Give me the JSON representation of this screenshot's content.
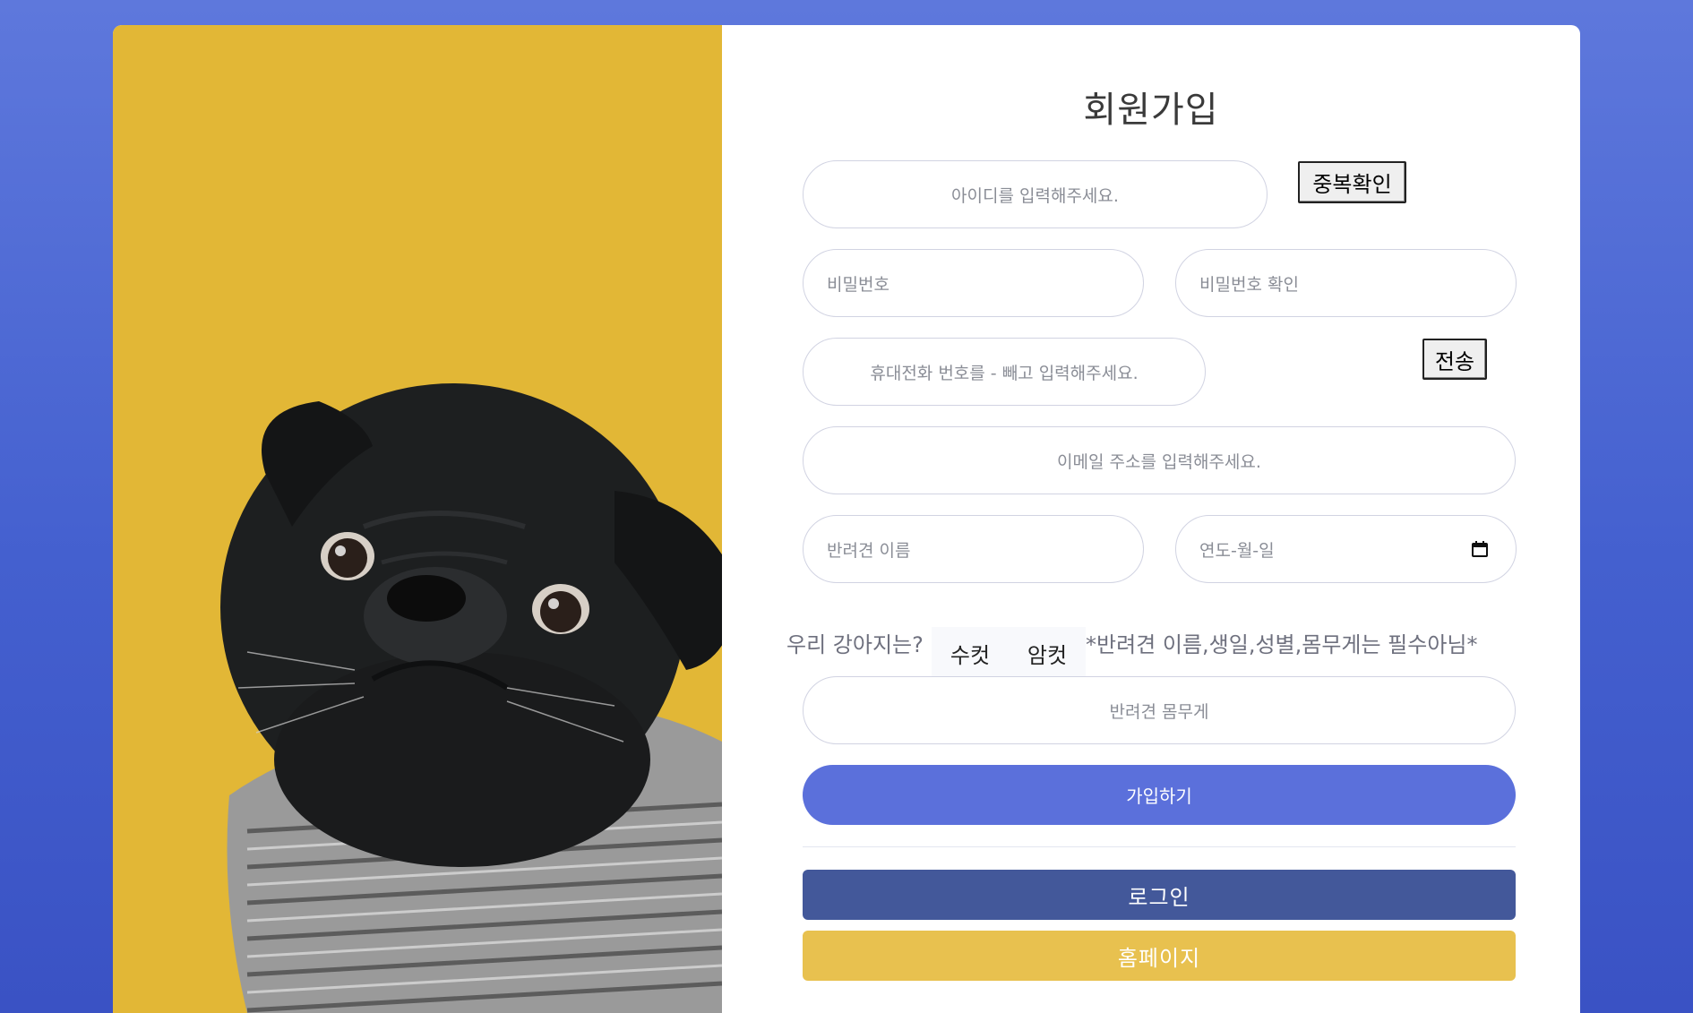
{
  "signup": {
    "title": "회원가입",
    "userid": {
      "placeholder": "아이디를 입력해주세요.",
      "check_button": "중복확인"
    },
    "password": {
      "placeholder": "비밀번호"
    },
    "password_confirm": {
      "placeholder": "비밀번호 확인"
    },
    "phone": {
      "placeholder": "휴대전화 번호를 - 빼고 입력해주세요.",
      "send_button": "전송"
    },
    "email": {
      "placeholder": "이메일 주소를 입력해주세요."
    },
    "pet_name": {
      "placeholder": "반려견 이름"
    },
    "pet_birthday": {
      "placeholder": "연도-월-일",
      "icon": "calendar-icon"
    },
    "gender": {
      "label": "우리 강아지는?",
      "options": [
        "수컷",
        "암컷"
      ],
      "note": "*반려견 이름,생일,성별,몸무게는 필수아님*"
    },
    "pet_weight": {
      "placeholder": "반려견 몸무게"
    },
    "submit_label": "가입하기",
    "login_label": "로그인",
    "home_label": "홈페이지"
  },
  "colors": {
    "background": "#4e68d5",
    "primary": "#5b70db",
    "login": "#43589a",
    "home": "#e8c14f",
    "photo_bg": "#e2b736"
  }
}
